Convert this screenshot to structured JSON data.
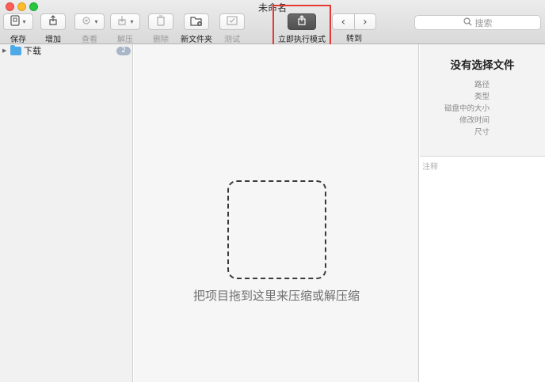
{
  "window": {
    "title": "未命名"
  },
  "toolbar": {
    "save": "保存",
    "add": "增加",
    "view": "查看",
    "extract": "解压",
    "delete": "删除",
    "new_folder": "新文件夹",
    "test": "测试",
    "instant_mode": "立即执行模式",
    "goto": "转到",
    "search_placeholder": "搜索"
  },
  "sidebar": {
    "items": [
      {
        "label": "下载",
        "count": "2"
      }
    ]
  },
  "main": {
    "drop_hint": "把项目拖到这里来压缩或解压缩"
  },
  "info": {
    "title": "没有选择文件",
    "fields": {
      "path": "路径",
      "type": "类型",
      "disk_size": "磁盘中的大小",
      "modified": "修改时间",
      "dimensions": "尺寸"
    },
    "notes_placeholder": "注释"
  },
  "colors": {
    "highlight_box": "#e53935",
    "folder_icon": "#4ea9e8",
    "badge": "#a9b6c7"
  }
}
